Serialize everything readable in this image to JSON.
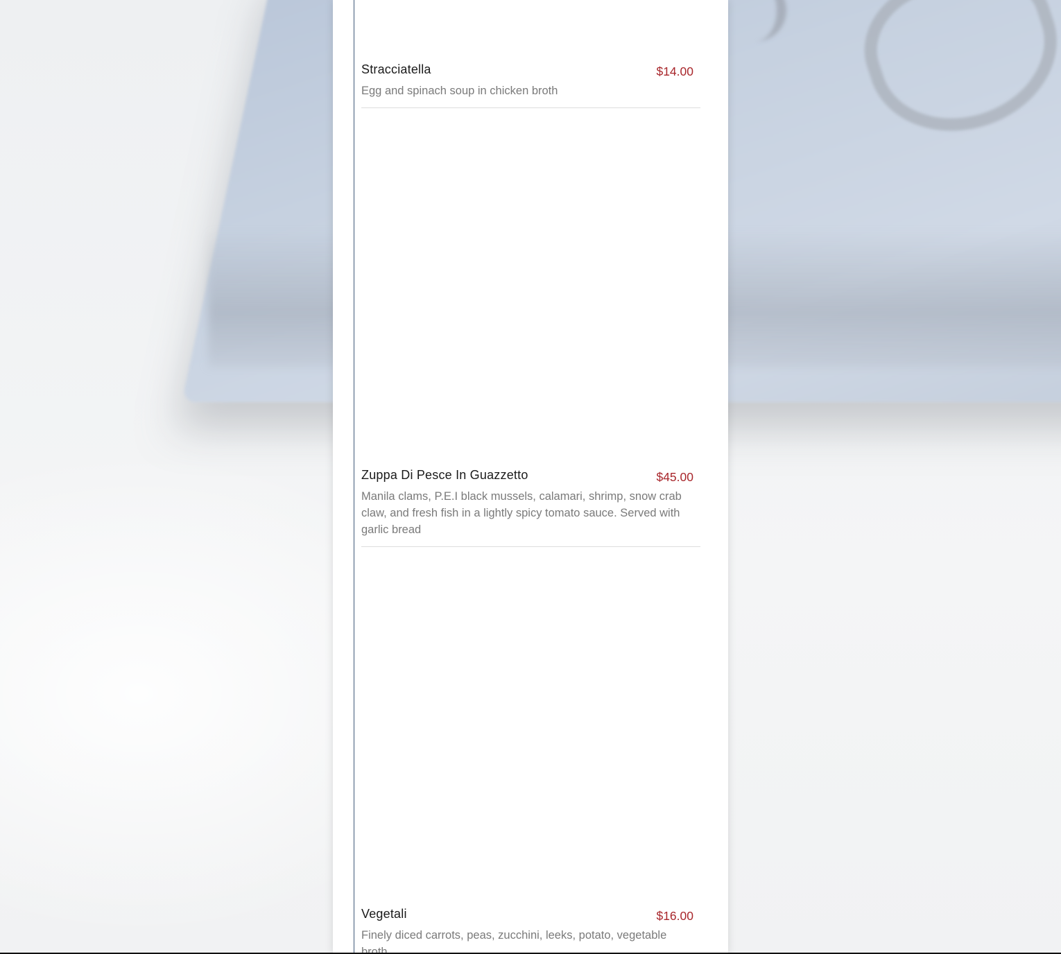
{
  "menu": {
    "items": [
      {
        "name": "Stracciatella",
        "price": "$14.00",
        "description": "Egg and spinach soup in chicken broth"
      },
      {
        "name": "Zuppa Di Pesce In Guazzetto",
        "price": "$45.00",
        "description": "Manila clams, P.E.I black mussels, calamari, shrimp, snow crab claw, and fresh fish in a lightly spicy tomato sauce. Served with garlic bread"
      },
      {
        "name": "Vegetali",
        "price": "$16.00",
        "description": "Finely diced carrots, peas, zucchini, leeks, potato, vegetable broth"
      }
    ]
  },
  "colors": {
    "price": "#a8262b",
    "name": "#1a1a1a",
    "description": "#7a7a7a",
    "accent_rule": "#3f5878"
  }
}
